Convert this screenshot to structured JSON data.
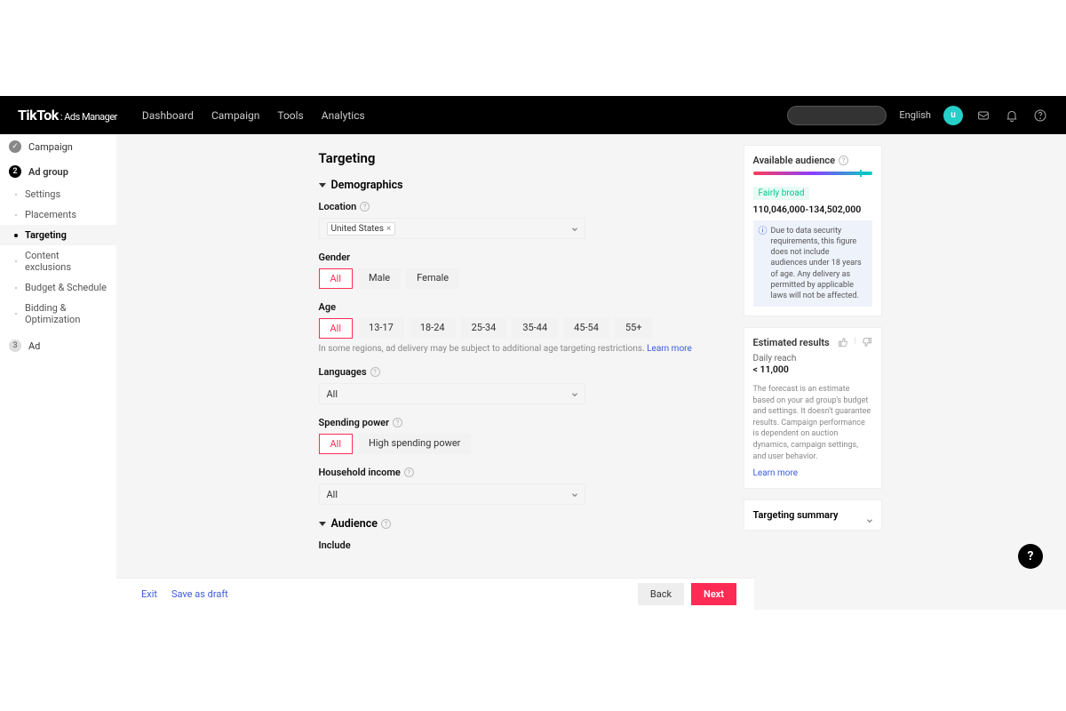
{
  "header": {
    "brand": "TikTok",
    "brand_sub": ": Ads Manager",
    "nav": [
      "Dashboard",
      "Campaign",
      "Tools",
      "Analytics"
    ],
    "language": "English",
    "avatar_initial": "u"
  },
  "sidebar": {
    "campaign": "Campaign",
    "adgroup": "Ad group",
    "adgroup_num": "2",
    "items": [
      "Settings",
      "Placements",
      "Targeting",
      "Content exclusions",
      "Budget & Schedule",
      "Bidding & Optimization"
    ],
    "ad": "Ad",
    "ad_num": "3"
  },
  "targeting": {
    "title": "Targeting",
    "demographics": "Demographics",
    "location_label": "Location",
    "location_chip": "United States",
    "gender_label": "Gender",
    "gender_options": [
      "All",
      "Male",
      "Female"
    ],
    "age_label": "Age",
    "age_options": [
      "All",
      "13-17",
      "18-24",
      "25-34",
      "35-44",
      "45-54",
      "55+"
    ],
    "age_note": "In some regions, ad delivery may be subject to additional age targeting restrictions.",
    "learn_more": "Learn more",
    "languages_label": "Languages",
    "languages_value": "All",
    "spending_label": "Spending power",
    "spending_options": [
      "All",
      "High spending power"
    ],
    "household_label": "Household income",
    "household_value": "All",
    "audience": "Audience",
    "include": "Include"
  },
  "aside": {
    "available_audience": "Available audience",
    "broad": "Fairly broad",
    "range": "110,046,000-134,502,000",
    "notice": "Due to data security requirements, this figure does not include audiences under 18 years of age. Any delivery as permitted by applicable laws will not be affected.",
    "estimated_results": "Estimated results",
    "daily_reach": "Daily reach",
    "daily_reach_val": "< 11,000",
    "forecast_note": "The forecast is an estimate based on your ad group's budget and settings. It doesn't guarantee results. Campaign performance is dependent on auction dynamics, campaign settings, and user behavior.",
    "learn_more": "Learn more",
    "targeting_summary": "Targeting summary"
  },
  "footer": {
    "exit": "Exit",
    "save_draft": "Save as draft",
    "back": "Back",
    "next": "Next"
  }
}
